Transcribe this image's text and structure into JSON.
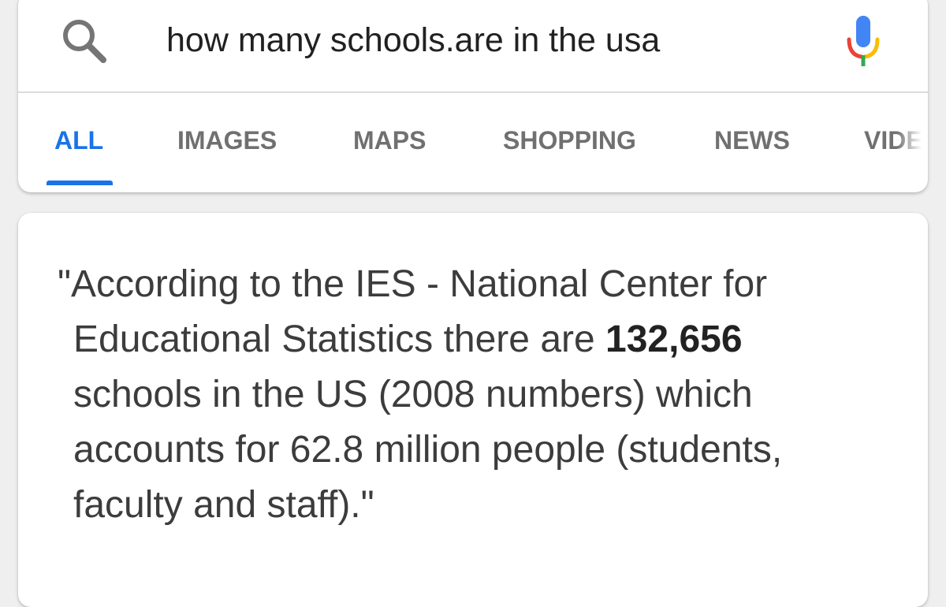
{
  "search": {
    "query": "how many schools.are in the usa",
    "icon": "search-icon",
    "mic_icon": "microphone-icon"
  },
  "tabs": [
    {
      "label": "ALL",
      "active": true
    },
    {
      "label": "IMAGES",
      "active": false
    },
    {
      "label": "MAPS",
      "active": false
    },
    {
      "label": "SHOPPING",
      "active": false
    },
    {
      "label": "NEWS",
      "active": false
    },
    {
      "label": "VIDE",
      "active": false
    }
  ],
  "answer": {
    "line1": "\"According to the IES - National Center for",
    "line2_pre": "Educational Statistics there are ",
    "line2_bold": "132,656",
    "line3": "schools in the US (2008 numbers) which",
    "line4": "accounts for 62.8 million people (students,",
    "line5": "faculty and staff).\""
  },
  "colors": {
    "accent": "#1a73e8",
    "mic_blue": "#4285f4",
    "mic_red": "#ea4335",
    "mic_yellow": "#fbbc05",
    "mic_green": "#34a853"
  }
}
